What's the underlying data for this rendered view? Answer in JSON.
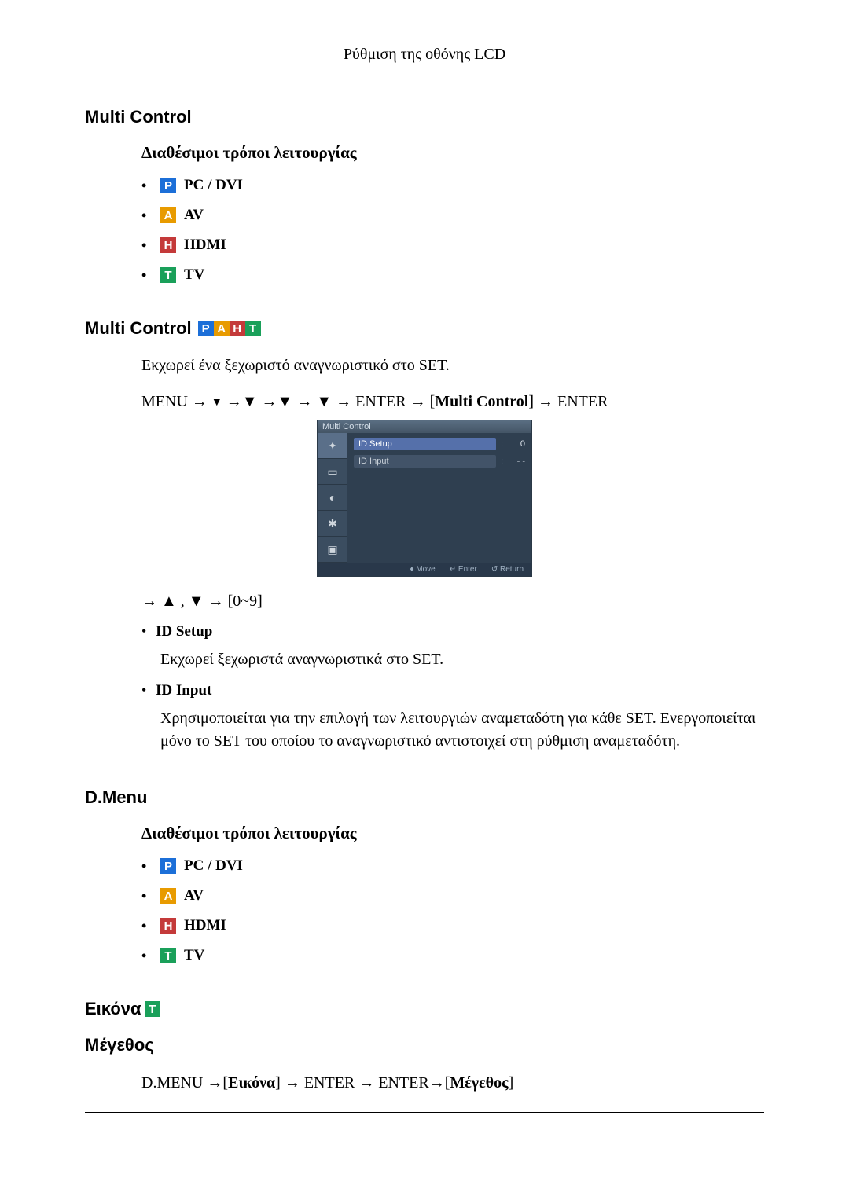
{
  "header": {
    "running": "Ρύθμιση της οθόνης LCD"
  },
  "sections": {
    "multiControl1": {
      "title": "Multi Control"
    },
    "availableModesTitle": "Διαθέσιμοι τρόποι λειτουργίας",
    "modes": {
      "pc": {
        "letter": "P",
        "label": "PC / DVI"
      },
      "av": {
        "letter": "A",
        "label": "AV"
      },
      "hdmi": {
        "letter": "H",
        "label": "HDMI"
      },
      "tv": {
        "letter": "T",
        "label": "TV"
      }
    },
    "multiControl2": {
      "title": "Multi Control",
      "intro": "Εκχωρεί ένα ξεχωριστό αναγνωριστικό στο SET.",
      "menuPath": {
        "pre": "MENU → ",
        "arrows1": "▼",
        "arrows2": " →▼ →▼ → ▼ → ENTER → [",
        "bold": "Multi Control",
        "post": "] → ENTER"
      },
      "arrowLine": "→ ▲ , ▼ → [0~9]",
      "idSetup": {
        "label": "ID Setup",
        "desc": "Εκχωρεί ξεχωριστά αναγνωριστικά στο SET."
      },
      "idInput": {
        "label": "ID Input",
        "desc": "Χρησιμοποιείται για την επιλογή των λειτουργιών αναμεταδότη για κάθε SET. Ενεργοποιείται μόνο το SET του οποίου το αναγνωριστικό αντιστοιχεί στη ρύθμιση αναμεταδότη."
      }
    },
    "dmenu": {
      "title": "D.Menu"
    },
    "picture": {
      "title": "Εικόνα",
      "sizeTitle": "Μέγεθος",
      "menuPath": {
        "pre": "D.MENU →[",
        "bold1": "Εικόνα",
        "mid": "] → ENTER → ENTER→[",
        "bold2": "Μέγεθος",
        "post": "]"
      }
    }
  },
  "osd": {
    "title": "Multi Control",
    "row1": {
      "label": "ID Setup",
      "value": "0"
    },
    "row2": {
      "label": "ID Input",
      "value": "- -"
    },
    "footer": {
      "move": "Move",
      "enter": "Enter",
      "ret": "Return"
    },
    "sideGlyphs": [
      "✦",
      "▭",
      "◐",
      "✱",
      "▣"
    ]
  }
}
